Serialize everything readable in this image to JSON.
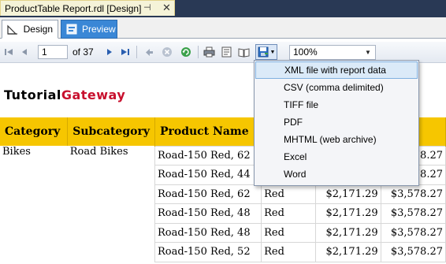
{
  "document": {
    "tab_title": "ProductTable Report.rdl [Design]"
  },
  "view_tabs": {
    "design": "Design",
    "preview": "Preview"
  },
  "toolbar": {
    "page": "1",
    "of_pages": "of 37",
    "zoom": "100%"
  },
  "brand": {
    "part1": "Tutorial",
    "part2": "Gateway"
  },
  "table": {
    "headers": [
      "Category",
      "Subcategory",
      "Product Name"
    ],
    "category": "Bikes",
    "subcategory": "Road Bikes",
    "rows": [
      {
        "product": "Road-150 Red, 62",
        "color": "",
        "cost": "",
        "price": "$3,578.27"
      },
      {
        "product": "Road-150 Red, 44",
        "color": "",
        "cost": "",
        "price": "$3,578.27"
      },
      {
        "product": "Road-150 Red, 62",
        "color": "Red",
        "cost": "$2,171.29",
        "price": "$3,578.27"
      },
      {
        "product": "Road-150 Red, 48",
        "color": "Red",
        "cost": "$2,171.29",
        "price": "$3,578.27"
      },
      {
        "product": "Road-150 Red, 48",
        "color": "Red",
        "cost": "$2,171.29",
        "price": "$3,578.27"
      },
      {
        "product": "Road-150 Red, 52",
        "color": "Red",
        "cost": "$2,171.29",
        "price": "$3,578.27"
      }
    ]
  },
  "export_menu": {
    "items": [
      "XML file with report data",
      "CSV (comma delimited)",
      "TIFF file",
      "PDF",
      "MHTML (web archive)",
      "Excel",
      "Word"
    ],
    "highlighted": "XML file with report data"
  },
  "colors": {
    "header_bg": "#f6c600",
    "brand_accent": "#c8102e",
    "preview_tab": "#3a87d6",
    "doc_strip": "#293955"
  }
}
